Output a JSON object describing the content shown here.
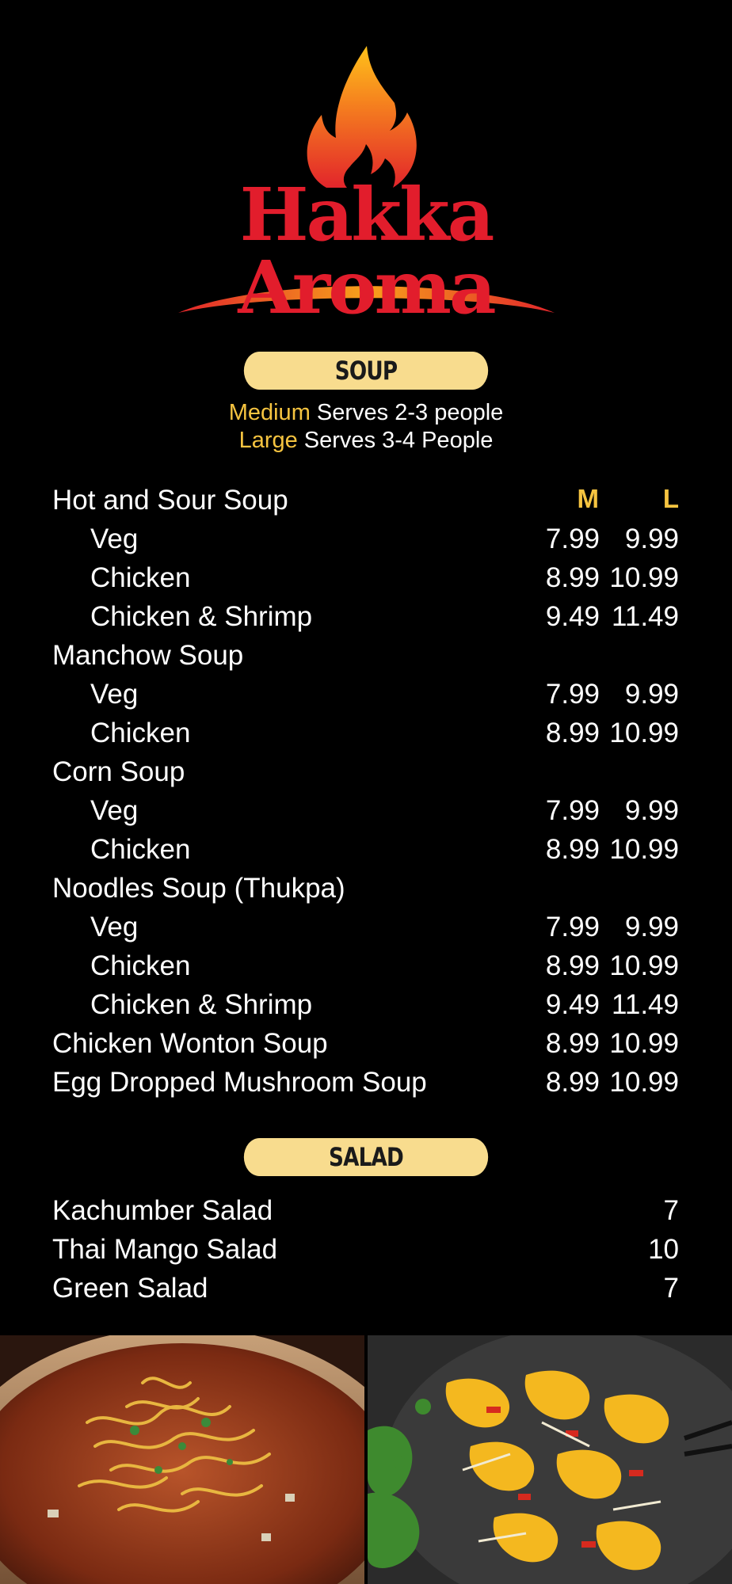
{
  "brand": {
    "name": "Hakka Aroma"
  },
  "sections": {
    "soup": {
      "title": "SOUP",
      "serves_medium_label": "Medium",
      "serves_medium_text": " Serves 2-3 people",
      "serves_large_label": "Large",
      "serves_large_text": " Serves 3-4 People",
      "col_m": "M",
      "col_l": "L",
      "rows": [
        {
          "name": "Hot and Sour Soup",
          "m": "",
          "l": ""
        },
        {
          "name": "Veg",
          "m": "7.99",
          "l": "9.99"
        },
        {
          "name": "Chicken",
          "m": "8.99",
          "l": "10.99"
        },
        {
          "name": "Chicken & Shrimp",
          "m": "9.49",
          "l": "11.49"
        },
        {
          "name": "Manchow Soup",
          "m": "",
          "l": ""
        },
        {
          "name": "Veg",
          "m": "7.99",
          "l": "9.99"
        },
        {
          "name": "Chicken",
          "m": "8.99",
          "l": "10.99"
        },
        {
          "name": "Corn Soup",
          "m": "",
          "l": ""
        },
        {
          "name": "Veg",
          "m": "7.99",
          "l": "9.99"
        },
        {
          "name": "Chicken",
          "m": "8.99",
          "l": "10.99"
        },
        {
          "name": "Noodles Soup (Thukpa)",
          "m": "",
          "l": ""
        },
        {
          "name": "Veg",
          "m": "7.99",
          "l": "9.99"
        },
        {
          "name": "Chicken",
          "m": "8.99",
          "l": "10.99"
        },
        {
          "name": "Chicken & Shrimp",
          "m": "9.49",
          "l": "11.49"
        },
        {
          "name": "Chicken Wonton Soup",
          "m": "8.99",
          "l": "10.99"
        },
        {
          "name": "Egg Dropped Mushroom Soup",
          "m": "8.99",
          "l": "10.99"
        }
      ]
    },
    "salad": {
      "title": "SALAD",
      "rows": [
        {
          "name": "Kachumber Salad",
          "price": "7"
        },
        {
          "name": "Thai Mango Salad",
          "price": "10"
        },
        {
          "name": "Green Salad",
          "price": "7"
        }
      ]
    }
  },
  "colors": {
    "background": "#000000",
    "pill": "#f8dc8e",
    "accent_yellow": "#f6c440",
    "brand_red": "#e21d2c",
    "flame_orange": "#f47a1f"
  },
  "images": {
    "left": "soup-bowl-photo",
    "right": "mango-salad-photo"
  }
}
